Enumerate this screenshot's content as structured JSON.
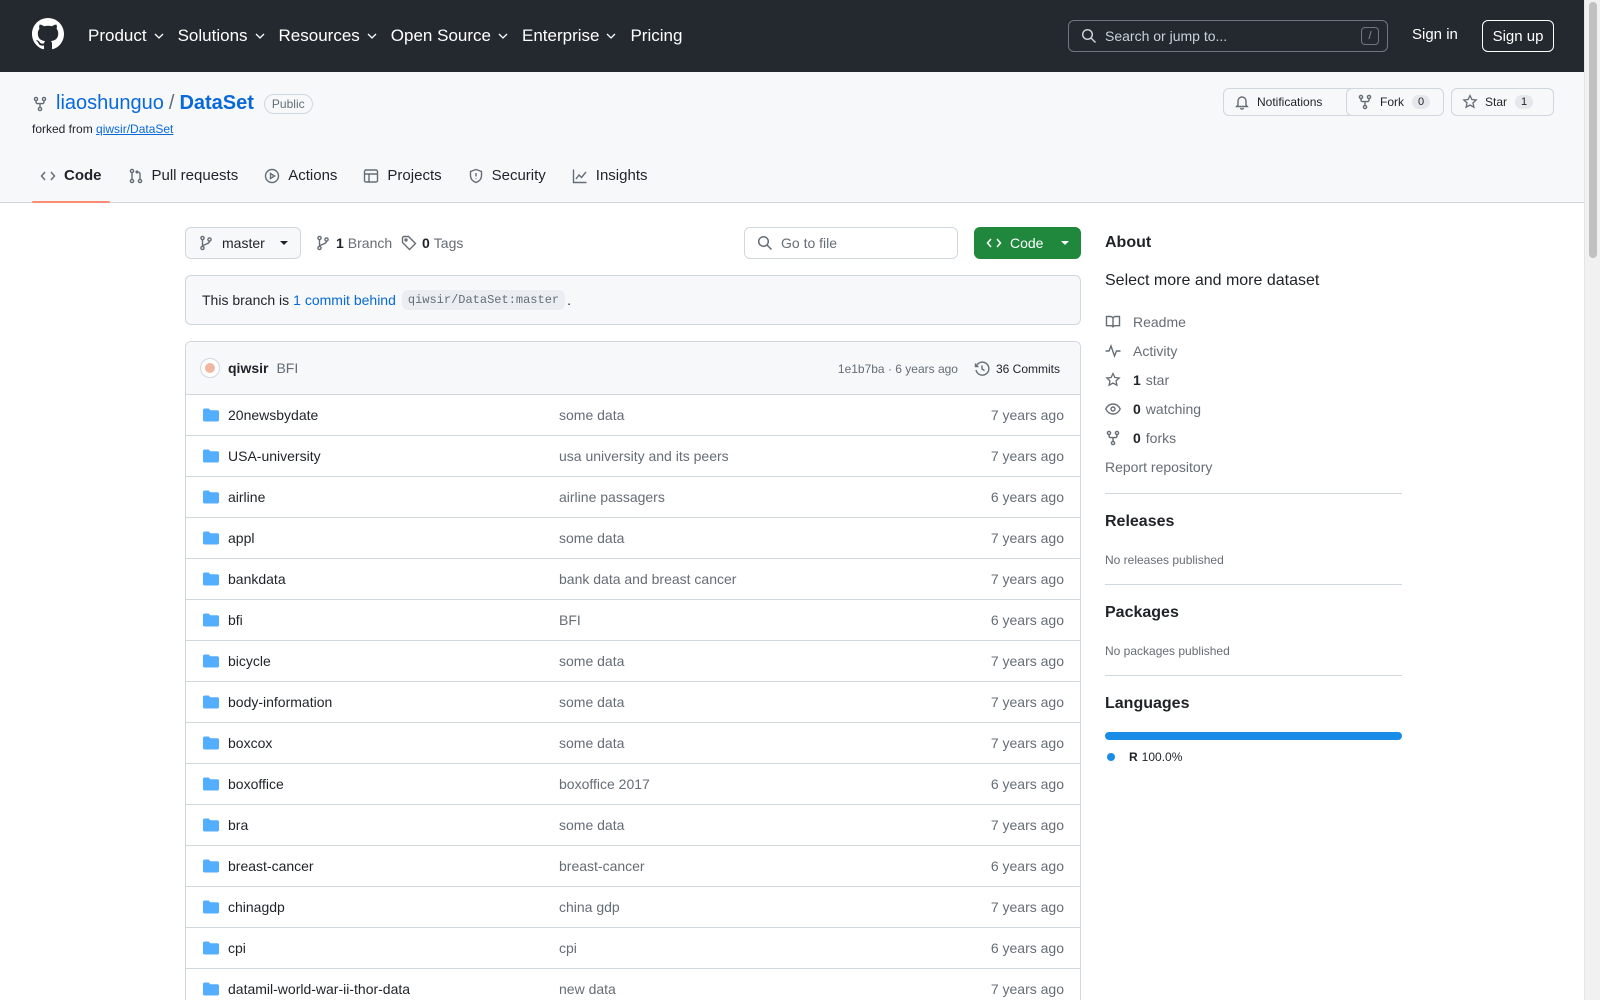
{
  "nav": {
    "items": [
      "Product",
      "Solutions",
      "Resources",
      "Open Source",
      "Enterprise",
      "Pricing"
    ],
    "search_placeholder": "Search or jump to...",
    "search_shortcut": "/",
    "sign_in": "Sign in",
    "sign_up": "Sign up"
  },
  "repo": {
    "owner": "liaoshunguo",
    "separator": "/",
    "name": "DataSet",
    "visibility": "Public",
    "forked_from_label": "forked from",
    "forked_from": "qiwsir/DataSet",
    "notifications_label": "Notifications",
    "fork_label": "Fork",
    "fork_count": "0",
    "star_label": "Star",
    "star_count": "1"
  },
  "tabs": [
    "Code",
    "Pull requests",
    "Actions",
    "Projects",
    "Security",
    "Insights"
  ],
  "toolbar": {
    "branch": "master",
    "branches_count": "1",
    "branches_label": "Branch",
    "tags_count": "0",
    "tags_label": "Tags",
    "goto_placeholder": "Go to file",
    "code_label": "Code"
  },
  "behind": {
    "prefix": "This branch is",
    "link": "1 commit behind",
    "ref": "qiwsir/DataSet:master",
    "suffix": "."
  },
  "latest_commit": {
    "author": "qiwsir",
    "message": "BFI",
    "hash_time": "1e1b7ba · 6 years ago",
    "commits_label": "36 Commits"
  },
  "files": [
    {
      "name": "20newsbydate",
      "message": "some data",
      "date": "7 years ago"
    },
    {
      "name": "USA-university",
      "message": "usa university and its peers",
      "date": "7 years ago"
    },
    {
      "name": "airline",
      "message": "airline passagers",
      "date": "6 years ago"
    },
    {
      "name": "appl",
      "message": "some data",
      "date": "7 years ago"
    },
    {
      "name": "bankdata",
      "message": "bank data and breast cancer",
      "date": "7 years ago"
    },
    {
      "name": "bfi",
      "message": "BFI",
      "date": "6 years ago"
    },
    {
      "name": "bicycle",
      "message": "some data",
      "date": "7 years ago"
    },
    {
      "name": "body-information",
      "message": "some data",
      "date": "7 years ago"
    },
    {
      "name": "boxcox",
      "message": "some data",
      "date": "7 years ago"
    },
    {
      "name": "boxoffice",
      "message": "boxoffice 2017",
      "date": "6 years ago"
    },
    {
      "name": "bra",
      "message": "some data",
      "date": "7 years ago"
    },
    {
      "name": "breast-cancer",
      "message": "breast-cancer",
      "date": "6 years ago"
    },
    {
      "name": "chinagdp",
      "message": "china gdp",
      "date": "7 years ago"
    },
    {
      "name": "cpi",
      "message": "cpi",
      "date": "6 years ago"
    },
    {
      "name": "datamil-world-war-ii-thor-data",
      "message": "new data",
      "date": "7 years ago"
    }
  ],
  "about": {
    "title": "About",
    "description": "Select more and more dataset",
    "readme": "Readme",
    "activity": "Activity",
    "stars_count": "1",
    "stars_label": "star",
    "watching_count": "0",
    "watching_label": "watching",
    "forks_count": "0",
    "forks_label": "forks",
    "report": "Report repository"
  },
  "releases": {
    "title": "Releases",
    "empty": "No releases published"
  },
  "packages": {
    "title": "Packages",
    "empty": "No packages published"
  },
  "languages": {
    "title": "Languages",
    "name": "R",
    "percent": "100.0%",
    "color": "#198CE7"
  }
}
